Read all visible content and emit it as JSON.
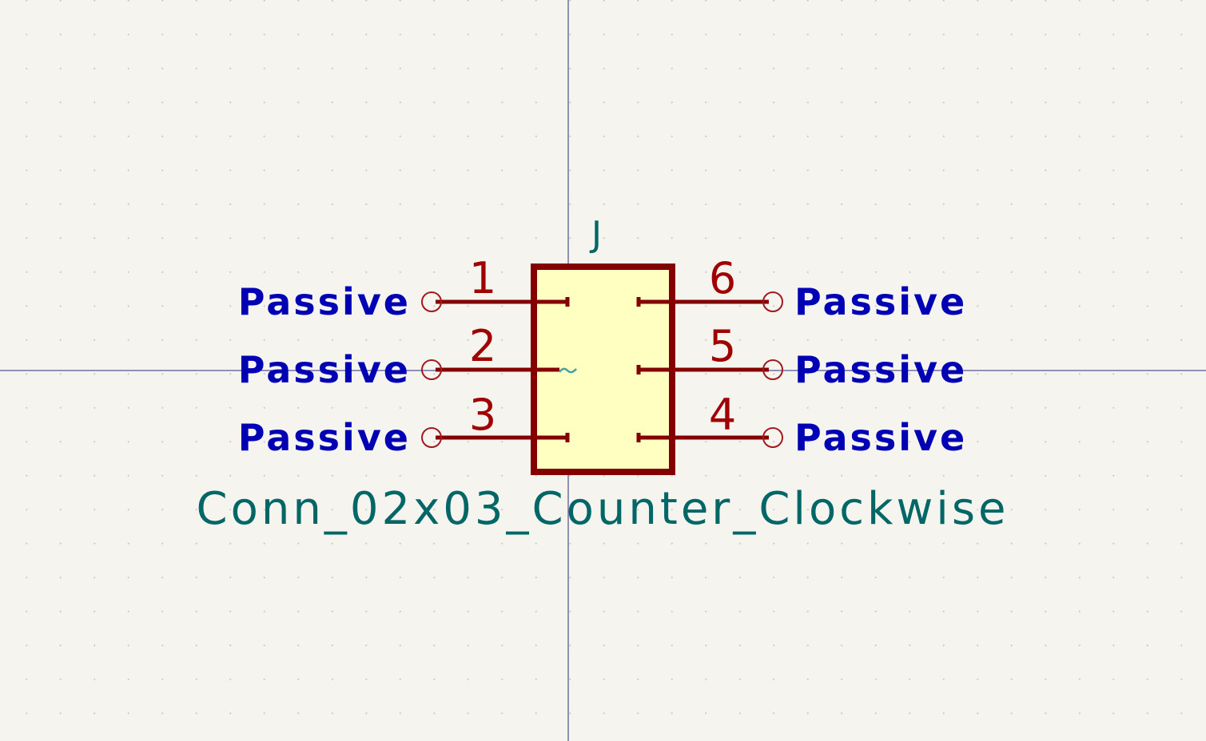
{
  "symbol": {
    "reference": "J",
    "value": "Conn_02x03_Counter_Clockwise",
    "pins": [
      {
        "number": "1",
        "type": "Passive"
      },
      {
        "number": "2",
        "type": "Passive"
      },
      {
        "number": "3",
        "type": "Passive"
      },
      {
        "number": "6",
        "type": "Passive"
      },
      {
        "number": "5",
        "type": "Passive"
      },
      {
        "number": "4",
        "type": "Passive"
      }
    ]
  },
  "colors": {
    "background": "#f5f4ef",
    "grid_dot": "#c9c9c2",
    "crosshair": "#2a2a78",
    "body_fill": "#ffffc2",
    "body_outline": "#840000",
    "pin_number": "#a00000",
    "pin_type": "#0000b4",
    "field_text": "#006666"
  }
}
